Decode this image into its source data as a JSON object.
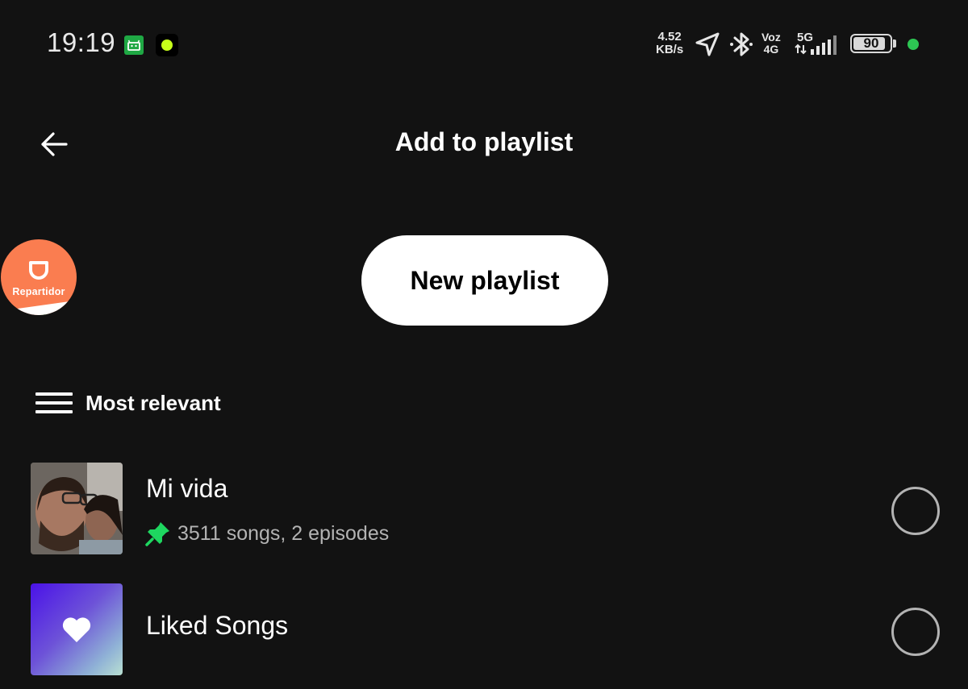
{
  "status_bar": {
    "time": "19:19",
    "net_speed_value": "4.52",
    "net_speed_unit": "KB/s",
    "volte_label_top": "Voz",
    "volte_label_bottom": "4G",
    "network_type": "5G",
    "battery_level": "90",
    "battery_fraction": 0.9,
    "privacy_dot_color": "#2dc653",
    "icons": [
      "android-notification-icon",
      "app-notification-icon",
      "location-arrow-icon",
      "bluetooth-icon",
      "signal-strength-icon",
      "battery-icon"
    ]
  },
  "header": {
    "title": "Add to playlist",
    "back_icon": "arrow-left-icon"
  },
  "floating_bubble": {
    "label": "Repartidor",
    "color": "#fa7d50"
  },
  "new_playlist_button": {
    "label": "New playlist"
  },
  "sort": {
    "label": "Most relevant",
    "icon": "list-sort-icon"
  },
  "playlists": [
    {
      "title": "Mi vida",
      "subtitle": "3511 songs, 2 episodes",
      "pinned": true,
      "pin_color": "#1ed760",
      "selected": false
    },
    {
      "title": "Liked Songs",
      "subtitle": "",
      "pinned": false,
      "cover_icon": "heart-icon",
      "selected": false
    }
  ],
  "colors": {
    "background": "#121212",
    "text_primary": "#ffffff",
    "text_secondary": "#b3b3b3",
    "accent_green": "#1ed760"
  }
}
